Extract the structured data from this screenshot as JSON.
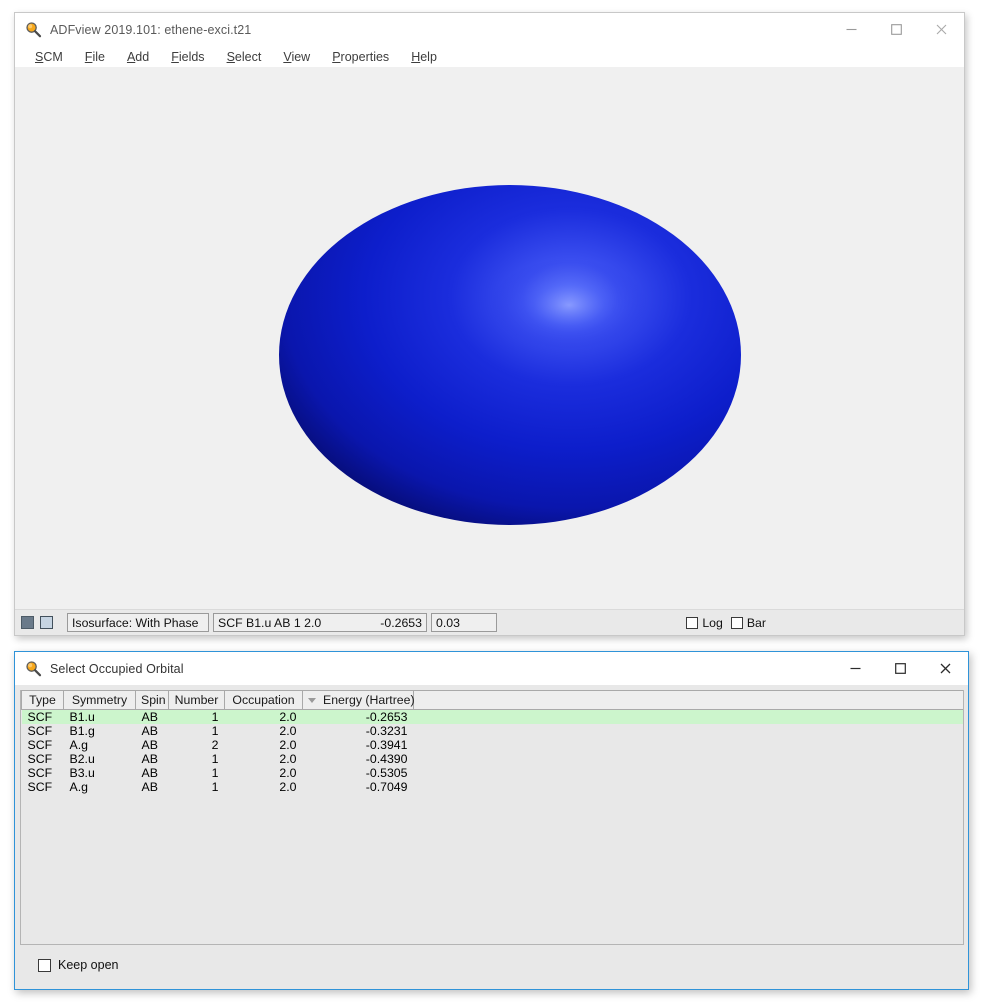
{
  "main_window": {
    "title": "ADFview 2019.101: ethene-exci.t21",
    "title_icon": "magnifier-icon",
    "controls": {
      "minimize": "minimize-icon",
      "maximize": "maximize-icon",
      "close": "close-icon"
    },
    "menu": [
      {
        "label": "SCM",
        "mnemonic": "S"
      },
      {
        "label": "File",
        "mnemonic": "F"
      },
      {
        "label": "Add",
        "mnemonic": "A"
      },
      {
        "label": "Fields",
        "mnemonic": "F"
      },
      {
        "label": "Select",
        "mnemonic": "S"
      },
      {
        "label": "View",
        "mnemonic": "V"
      },
      {
        "label": "Properties",
        "mnemonic": "P"
      },
      {
        "label": "Help",
        "mnemonic": "H"
      }
    ],
    "viewport": {
      "background_color": "#f0f0f0",
      "object": "molecular-orbital-isosurface",
      "object_color": "#0b1fcc",
      "highlight_color": "#4a63f5"
    },
    "statusbar": {
      "swatch_primary_color": "#6a7a8a",
      "swatch_secondary_color": "#c6d4e2",
      "isosurface_label": "Isosurface: With Phase",
      "orbital_label": "SCF B1.u AB 1 2.0",
      "orbital_energy": "-0.2653",
      "isovalue": "0.03",
      "log_label": "Log",
      "log_checked": false,
      "bar_label": "Bar",
      "bar_checked": false
    }
  },
  "orbital_window": {
    "title": "Select Occupied Orbital",
    "title_icon": "magnifier-icon",
    "accent_color": "#2f93d8",
    "controls": {
      "minimize": "minimize-icon",
      "maximize": "maximize-icon",
      "close": "close-icon"
    },
    "table": {
      "columns": [
        "Type",
        "Symmetry",
        "Spin",
        "Number",
        "Occupation",
        "Energy (Hartree)"
      ],
      "sorted_column": "Energy (Hartree)",
      "sort_direction": "descending",
      "selected_row_index": 0,
      "selected_row_color": "#ccf5cc",
      "rows": [
        {
          "type": "SCF",
          "symmetry": "B1.u",
          "spin": "AB",
          "number": "1",
          "occupation": "2.0",
          "energy": "-0.2653"
        },
        {
          "type": "SCF",
          "symmetry": "B1.g",
          "spin": "AB",
          "number": "1",
          "occupation": "2.0",
          "energy": "-0.3231"
        },
        {
          "type": "SCF",
          "symmetry": "A.g",
          "spin": "AB",
          "number": "2",
          "occupation": "2.0",
          "energy": "-0.3941"
        },
        {
          "type": "SCF",
          "symmetry": "B2.u",
          "spin": "AB",
          "number": "1",
          "occupation": "2.0",
          "energy": "-0.4390"
        },
        {
          "type": "SCF",
          "symmetry": "B3.u",
          "spin": "AB",
          "number": "1",
          "occupation": "2.0",
          "energy": "-0.5305"
        },
        {
          "type": "SCF",
          "symmetry": "A.g",
          "spin": "AB",
          "number": "1",
          "occupation": "2.0",
          "energy": "-0.7049"
        }
      ]
    },
    "footer": {
      "keep_open_label": "Keep open",
      "keep_open_checked": false
    }
  }
}
